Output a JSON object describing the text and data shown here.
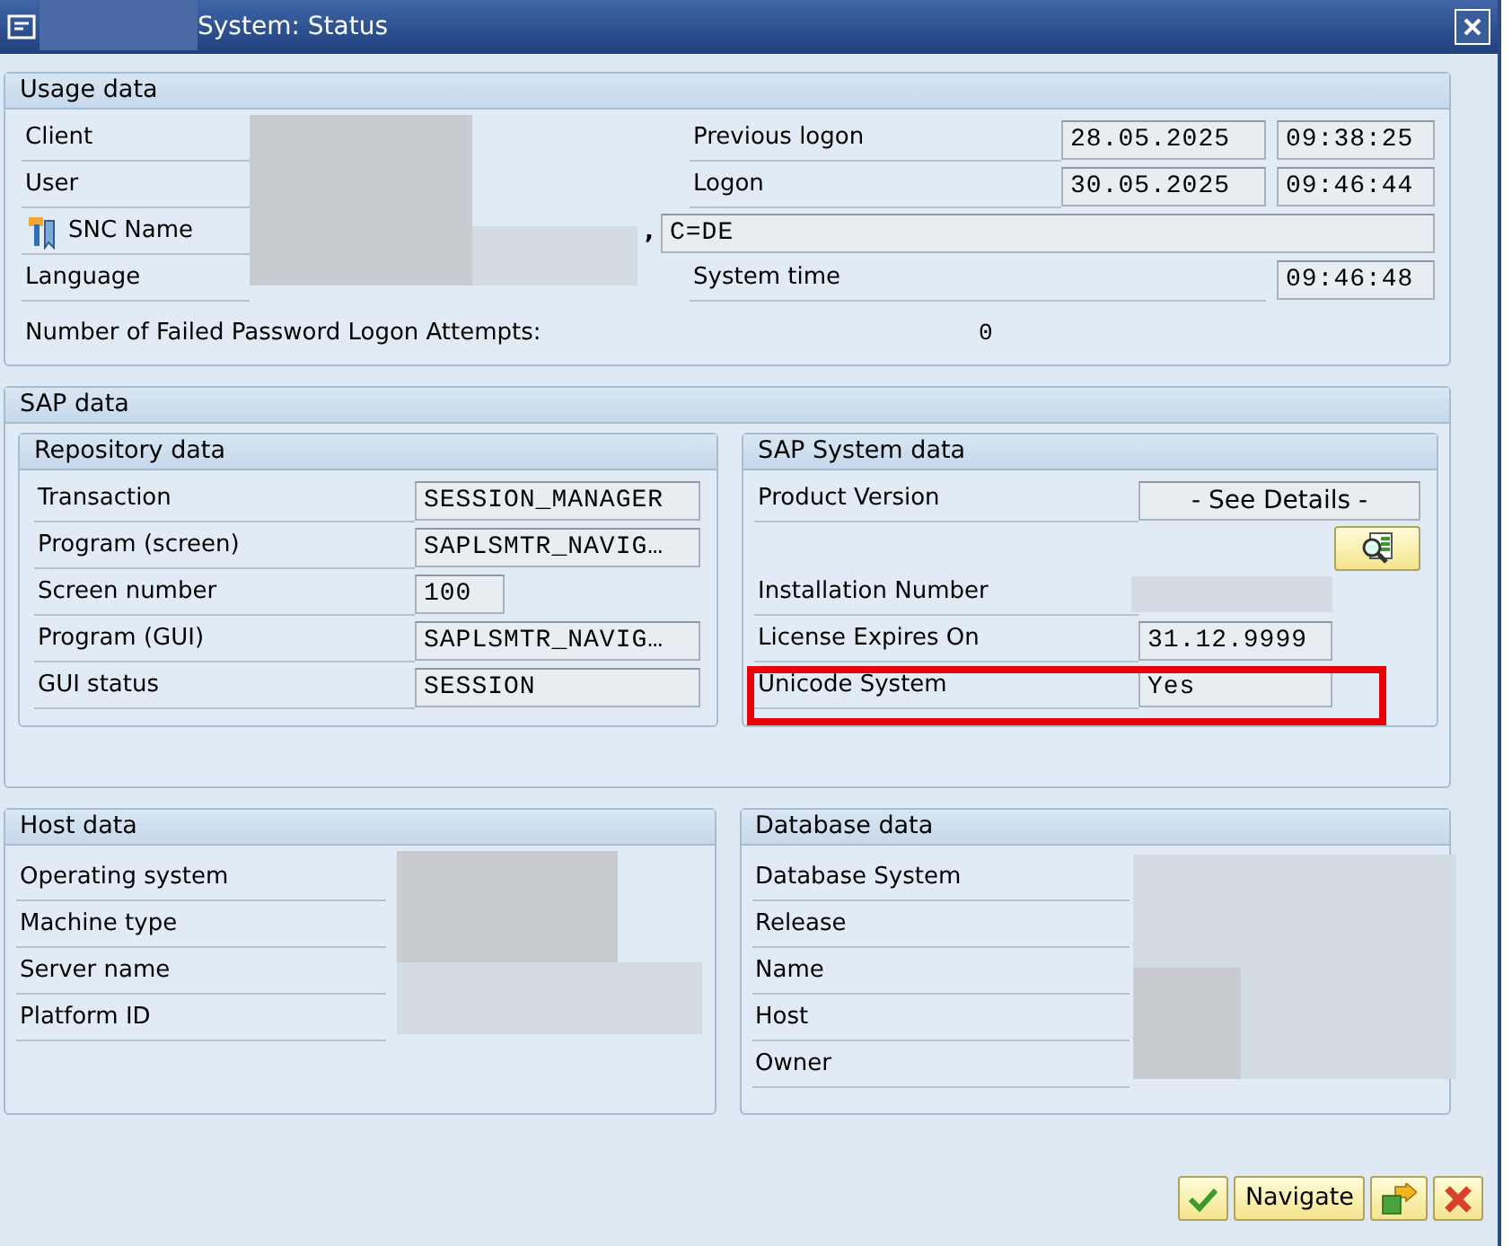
{
  "window": {
    "title": "System: Status"
  },
  "usage_data": {
    "title": "Usage data",
    "client_label": "Client",
    "user_label": "User",
    "snc_label": "SNC Name",
    "snc_prefix": ",",
    "snc_value": "C=DE",
    "language_label": "Language",
    "previous_logon": {
      "label": "Previous logon",
      "date": "28.05.2025",
      "time": "09:38:25"
    },
    "logon": {
      "label": "Logon",
      "date": "30.05.2025",
      "time": "09:46:44"
    },
    "system_time": {
      "label": "System time",
      "time": "09:46:48"
    },
    "failed_label": "Number of Failed Password Logon Attempts:",
    "failed_value": "0"
  },
  "sap_data": {
    "title": "SAP data",
    "repository": {
      "title": "Repository data",
      "rows": [
        {
          "label": "Transaction",
          "value": "SESSION_MANAGER"
        },
        {
          "label": "Program (screen)",
          "value": "SAPLSMTR_NAVIG…"
        },
        {
          "label": "Screen number",
          "value": "100"
        },
        {
          "label": "Program (GUI)",
          "value": "SAPLSMTR_NAVIG…"
        },
        {
          "label": "GUI status",
          "value": "SESSION"
        }
      ]
    },
    "system": {
      "title": "SAP System data",
      "rows": [
        {
          "kind": "field",
          "label": "Product Version",
          "value": "- See Details -",
          "highlighted": false
        },
        {
          "kind": "button",
          "highlighted": false
        },
        {
          "kind": "redacted",
          "label": "Installation Number",
          "highlighted": false
        },
        {
          "kind": "field",
          "label": "License Expires On",
          "value": "31.12.9999",
          "highlighted": false
        },
        {
          "kind": "field",
          "label": "Unicode System",
          "value": "Yes",
          "highlighted": true
        }
      ]
    }
  },
  "host_data": {
    "title": "Host data",
    "rows": [
      "Operating system",
      "Machine type",
      "Server name",
      "Platform ID"
    ]
  },
  "database_data": {
    "title": "Database data",
    "rows": [
      "Database System",
      "Release",
      "Name",
      "Host",
      "Owner"
    ]
  },
  "footer_buttons": [
    {
      "kind": "confirm"
    },
    {
      "kind": "text",
      "label": "Navigate"
    },
    {
      "kind": "exit"
    },
    {
      "kind": "cancel"
    }
  ]
}
